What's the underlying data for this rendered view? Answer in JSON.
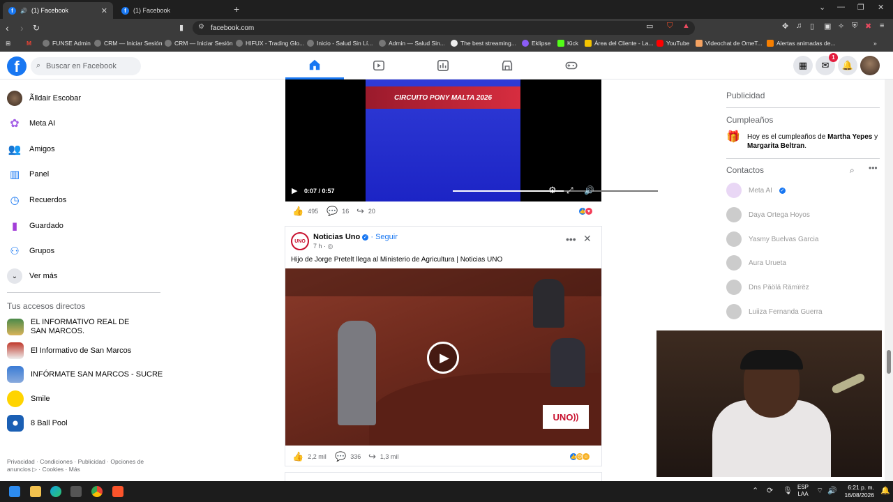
{
  "browser": {
    "tabs": [
      {
        "title": "(1) Facebook",
        "active": true
      },
      {
        "title": "(1) Facebook",
        "active": false
      }
    ],
    "new_tab": "+",
    "url": "facebook.com",
    "bookmarks": [
      "FUNSE Admin",
      "CRM — Iniciar Sesión",
      "CRM — Iniciar Sesión",
      "HIFUX - Trading Glo...",
      "Inicio - Salud Sin Lí...",
      "Admin — Salud Sin...",
      "The best streaming...",
      "Eklipse",
      "Kick",
      "Área del Cliente - La...",
      "YouTube",
      "Videochat de OmeT...",
      "Alertas animadas de..."
    ]
  },
  "fb": {
    "search_placeholder": "Buscar en Facebook",
    "messenger_badge": "1",
    "brand_color": "#1877f2"
  },
  "sidebar": {
    "items": [
      {
        "label": "Ãlldair Escobar",
        "icon": "avatar"
      },
      {
        "label": "Meta AI",
        "icon": "meta-ai-icon"
      },
      {
        "label": "Amigos",
        "icon": "friends-icon"
      },
      {
        "label": "Panel",
        "icon": "panel-icon"
      },
      {
        "label": "Recuerdos",
        "icon": "memories-icon"
      },
      {
        "label": "Guardado",
        "icon": "saved-icon"
      },
      {
        "label": "Grupos",
        "icon": "groups-icon"
      },
      {
        "label": "Ver más",
        "icon": "chevron-down-icon"
      }
    ],
    "shortcuts_title": "Tus accesos directos",
    "shortcuts": [
      "EL INFORMATIVO REAL DE SAN MARCOS.",
      "El Informativo de San Marcos",
      "INFÓRMATE SAN MARCOS - SUCRE",
      "Smile",
      "8 Ball Pool"
    ],
    "footer": "Privacidad · Condiciones · Publicidad · Opciones de anuncios ▷ · Cookies · Más"
  },
  "feed": {
    "post1": {
      "banner": "CIRCUITO PONY MALTA 2026",
      "time": "0:07 / 0:57",
      "progress": 0.54,
      "likes": "495",
      "comments": "16",
      "shares": "20"
    },
    "post2": {
      "author": "Noticias Uno",
      "follow": "Seguir",
      "time": "7 h",
      "text": "Hijo de Jorge Pretelt llega al Ministerio de Agricultura | Noticias UNO",
      "logo": "UNO",
      "likes": "2,2 mil",
      "comments": "336",
      "shares": "1,3 mil"
    }
  },
  "right": {
    "ads_title": "Publicidad",
    "birthdays_title": "Cumpleaños",
    "birthday_prefix": "Hoy es el cumpleaños de ",
    "birthday_name1": "Martha Yepes",
    "birthday_mid": " y ",
    "birthday_name2": "Margarita Beltran",
    "birthday_suffix": ".",
    "contacts_title": "Contactos",
    "contacts": [
      "Meta AI",
      "Daya Ortega Hoyos",
      "Yasmy Buelvas Garcia",
      "Aura Urueta",
      "Dns Päölä Rämïrëz",
      "Luiiza Fernanda Guerra"
    ]
  },
  "taskbar": {
    "lang1": "ESP",
    "lang2": "LAA",
    "time": "6:21 p. m.",
    "date": "16/08/2026"
  }
}
